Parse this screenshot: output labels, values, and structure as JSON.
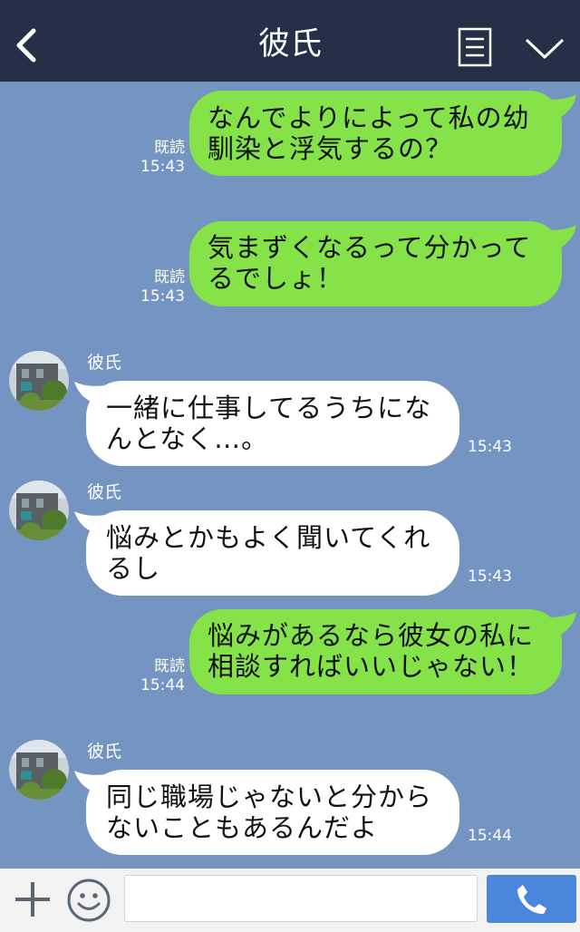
{
  "header": {
    "title": "彼氏",
    "back_icon": "back-arrow-icon",
    "menu_icon": "menu-list-icon",
    "more_icon": "chevron-down-icon"
  },
  "messages": [
    {
      "side": "out",
      "text": "なんでよりによって私の幼\n馴染と浮気するの？",
      "read": "既読",
      "time": "15:43"
    },
    {
      "side": "out",
      "text": "気まずくなるって分かって\nるでしょ！",
      "read": "既読",
      "time": "15:43"
    },
    {
      "side": "in",
      "sender": "彼氏",
      "text": "一緒に仕事してるうちにな\nんとなく…。",
      "time": "15:43"
    },
    {
      "side": "in",
      "sender": "彼氏",
      "text": "悩みとかもよく聞いてくれ\nるし",
      "time": "15:43"
    },
    {
      "side": "out",
      "text": "悩みがあるなら彼女の私に\n相談すればいいじゃない！",
      "read": "既読",
      "time": "15:44"
    },
    {
      "side": "in",
      "sender": "彼氏",
      "text": "同じ職場じゃないと分から\nないこともあるんだよ",
      "time": "15:44"
    }
  ],
  "input_bar": {
    "add_icon": "plus-icon",
    "emoji_icon": "smiley-icon",
    "message_value": "",
    "call_icon": "phone-icon"
  },
  "colors": {
    "background": "#7494c2",
    "header": "#253048",
    "out_bubble": "#85e249",
    "in_bubble": "#ffffff",
    "call_button": "#4a86db"
  }
}
